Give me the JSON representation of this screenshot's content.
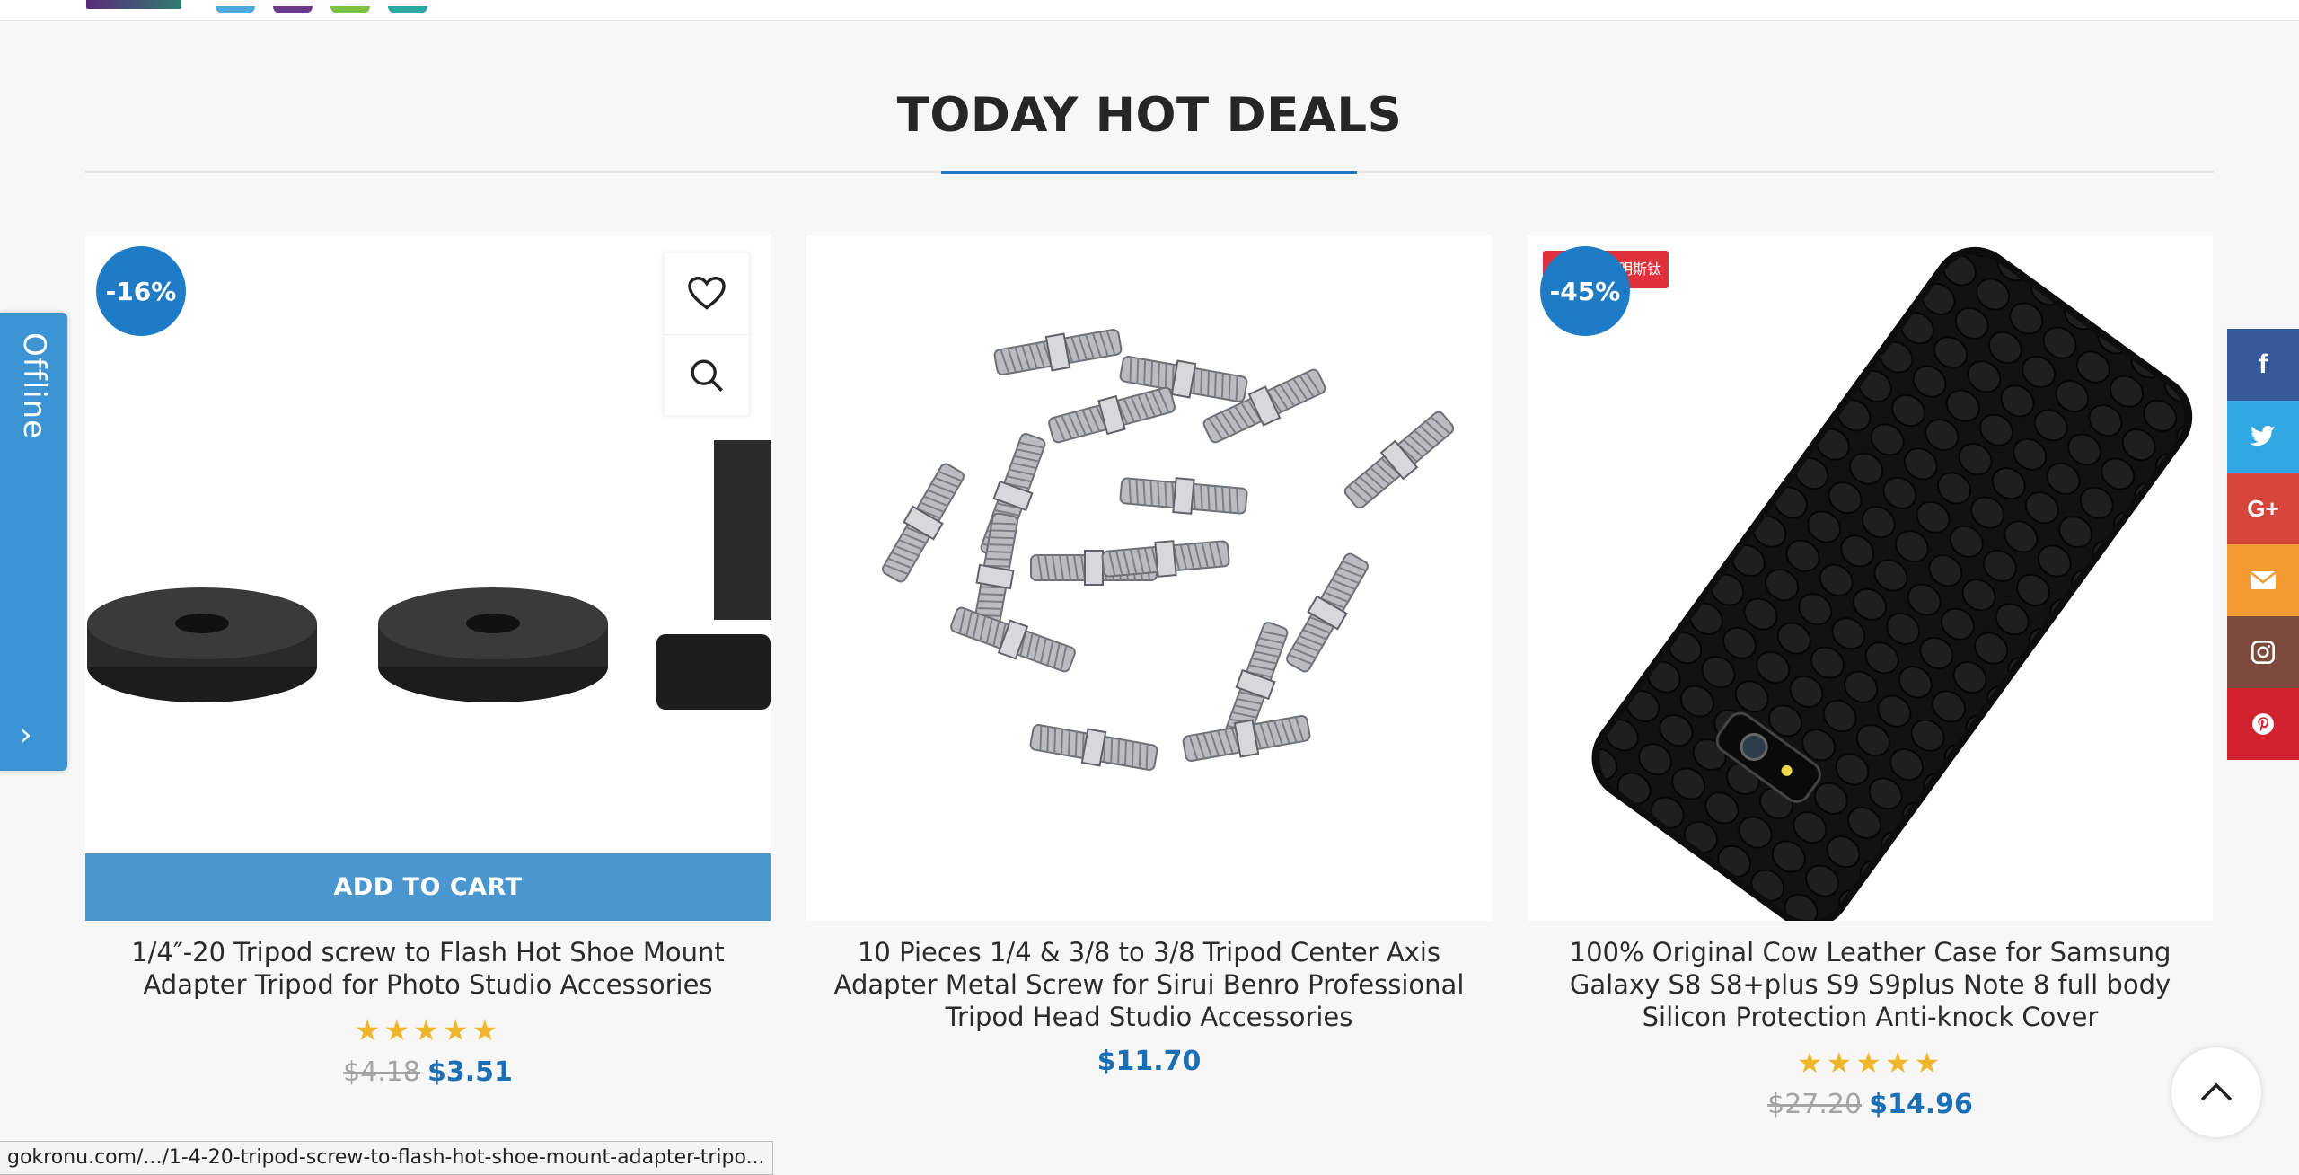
{
  "section": {
    "title": "TODAY HOT DEALS"
  },
  "products": [
    {
      "discount": "-16%",
      "title": "1/4″-20 Tripod screw to Flash Hot Shoe Mount Adapter Tripod for Photo Studio Accessories",
      "rating": 5,
      "stars": "★★★★★",
      "old_price": "$4.18",
      "price": "$3.51",
      "add_to_cart": "ADD TO CART"
    },
    {
      "discount": "",
      "title": "10 Pieces 1/4 & 3/8 to 3/8 Tripod Center Axis Adapter Metal Screw for Sirui Benro Professional Tripod Head Studio Accessories",
      "price": "$11.70"
    },
    {
      "discount": "-45%",
      "sticker_text": "明斯钛",
      "title": "100% Original Cow Leather Case for Samsung Galaxy S8 S8+plus S9 S9plus Note 8 full body Silicon Protection Anti-knock Cover",
      "rating": 5,
      "stars": "★★★★★",
      "old_price": "$27.20",
      "price": "$14.96"
    }
  ],
  "chat_widget": {
    "status": "Offline",
    "arrow": "›"
  },
  "social_bar": [
    "facebook-icon",
    "twitter-icon",
    "google-plus-icon",
    "email-icon",
    "instagram-icon",
    "pinterest-icon"
  ],
  "social_labels": {
    "facebook": "f",
    "google_plus": "G+"
  },
  "status_bar": {
    "url": "gokronu.com/.../1-4-20-tripod-screw-to-flash-hot-shoe-mount-adapter-tripo..."
  },
  "colors": {
    "accent": "#1e7cc6",
    "price": "#1c6fb4",
    "star": "#f0b62b",
    "add_to_cart_bg": "#4a97d0"
  }
}
